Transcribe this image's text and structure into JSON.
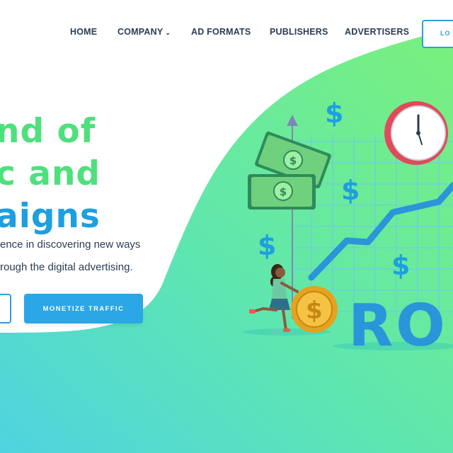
{
  "nav": {
    "items": [
      {
        "label": "HOME"
      },
      {
        "label": "COMPANY"
      },
      {
        "label": "AD FORMATS"
      },
      {
        "label": "PUBLISHERS"
      },
      {
        "label": "ADVERTISERS"
      }
    ],
    "login_label": "LO"
  },
  "hero": {
    "line1": "nd of",
    "line2": "c and",
    "line3": "aigns",
    "sub1": "ence in discovering new ways",
    "sub2": "rough the digital advertising."
  },
  "buttons": {
    "monetize_label": "MONETIZE TRAFFIC"
  },
  "illustration": {
    "roi_text": "ROI",
    "dollar_symbol": "$"
  },
  "colors": {
    "brand_blue": "#2ba6e6",
    "brand_green": "#4ee07c",
    "nav_text": "#2b3d55"
  }
}
